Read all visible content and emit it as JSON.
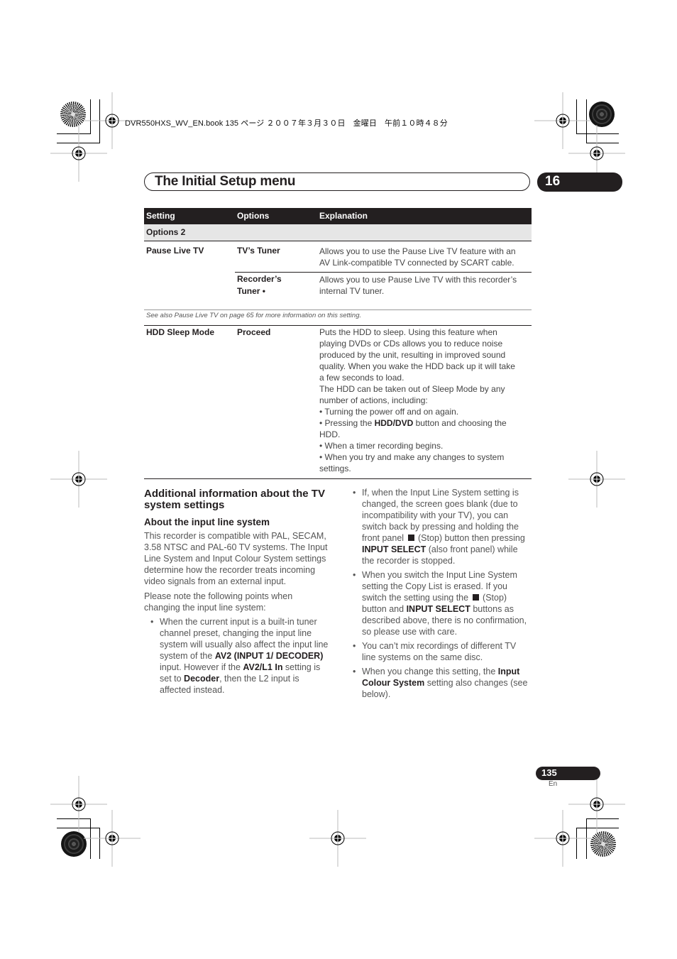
{
  "print_header": "DVR550HXS_WV_EN.book  135 ページ  ２００７年３月３０日　金曜日　午前１０時４８分",
  "chapter": {
    "title": "The Initial Setup menu",
    "number": "16"
  },
  "table": {
    "headers": [
      "Setting",
      "Options",
      "Explanation"
    ],
    "group": "Options 2",
    "rows": [
      {
        "setting": "Pause Live TV",
        "options": [
          {
            "label_lines": [
              "TV’s Tuner"
            ],
            "explanation_lines": [
              "Allows you to use the Pause Live TV feature with an",
              "AV Link-compatible TV connected by SCART cable."
            ]
          },
          {
            "label_lines": [
              "Recorder’s",
              "Tuner •"
            ],
            "explanation_lines": [
              "Allows you to use Pause Live TV with this recorder’s",
              "internal TV tuner."
            ]
          }
        ],
        "note": "See also Pause Live TV on page 65 for more information on this setting."
      },
      {
        "setting": "HDD Sleep Mode",
        "options": [
          {
            "label_lines": [
              "Proceed"
            ],
            "explanation_lines": [
              "Puts the HDD to sleep. Using this feature when",
              "playing DVDs or CDs allows you to reduce noise",
              "produced by the unit, resulting in improved sound",
              "quality. When you wake the HDD back up it will take",
              "a few seconds to load.",
              "The HDD can be taken out of Sleep Mode by any",
              "number of actions, including:",
              "• Turning the power off and on again.",
              "• Pressing the ",
              "HDD.",
              "• When a timer recording begins.",
              "• When you try and make any changes to system",
              "settings."
            ],
            "explanation_bold": "HDD/DVD",
            "explanation_after_bold": " button and choosing the"
          }
        ]
      }
    ]
  },
  "section": {
    "heading": "Additional information about the TV system settings",
    "subheading": "About the input line system",
    "intro": "This recorder is compatible with PAL, SECAM, 3.58 NTSC and PAL-60 TV systems. The Input Line System and Input Colour System settings determine how the recorder treats incoming video signals from an external input.",
    "note_intro": "Please note the following points when changing the input line system:",
    "bullet1": {
      "t1": "When the current input is a built-in tuner channel preset, changing the input line system will usually also affect the input line system of the ",
      "b1": "AV2 (INPUT 1/ DECODER)",
      "t2": " input. However if the ",
      "b2": "AV2/L1 In",
      "t3": " setting is set to ",
      "b3": "Decoder",
      "t4": ", then the L2 input is affected instead."
    },
    "bullet2": {
      "t1": "If, when the Input Line System setting is changed, the screen goes blank (due to incompatibility with your TV), you can switch back by pressing and holding the front panel ",
      "t2": " (Stop) button then pressing ",
      "b1": "INPUT SELECT",
      "t3": " (also front panel) while the recorder is stopped."
    },
    "bullet3": {
      "t1": "When you switch the Input Line System setting the Copy List is erased. If you switch the setting using the ",
      "t2": " (Stop) button and ",
      "b1": "INPUT SELECT",
      "t3": " buttons as described above, there is no confirmation, so please use with care."
    },
    "bullet4": "You can’t mix recordings of different TV line systems on the same disc.",
    "bullet5": {
      "t1": "When you change this setting, the ",
      "b1": "Input Colour System",
      "t2": " setting also changes (see below)."
    },
    "bullet_glyph": "•",
    "stop_icon": "stop-square-icon"
  },
  "footer": {
    "page_number": "135",
    "language": "En"
  }
}
